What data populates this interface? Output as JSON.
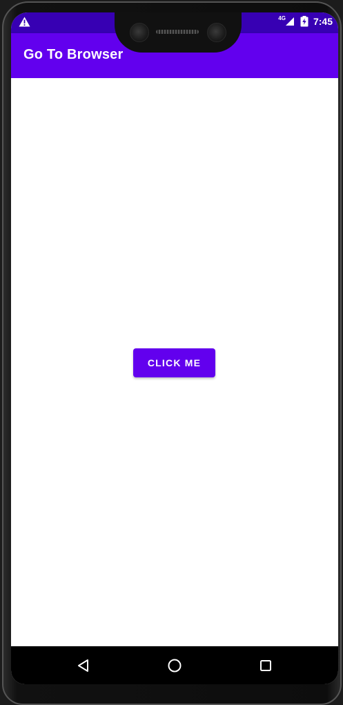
{
  "status_bar": {
    "time": "7:45",
    "network": "4G",
    "warning_icon": "warning-triangle-icon",
    "signal_icon": "cell-signal-icon",
    "battery_icon": "battery-charging-icon",
    "background_color": "#3700b3"
  },
  "app_bar": {
    "title": "Go To Browser",
    "background_color": "#6200ee"
  },
  "main": {
    "button_label": "CLICK ME",
    "button_color": "#6200ee"
  },
  "nav_bar": {
    "back_icon": "back-triangle-icon",
    "home_icon": "home-circle-icon",
    "recents_icon": "recents-square-icon"
  }
}
